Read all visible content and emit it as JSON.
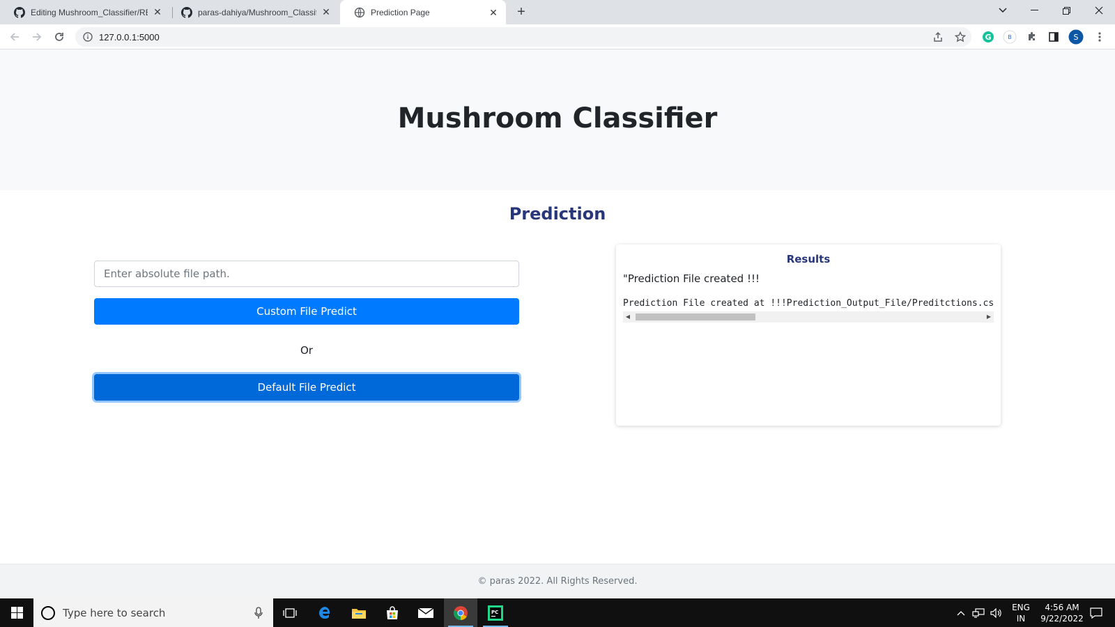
{
  "browser": {
    "tabs": [
      {
        "title": "Editing Mushroom_Classifier/REA",
        "icon": "github-icon"
      },
      {
        "title": "paras-dahiya/Mushroom_Classifi",
        "icon": "github-icon"
      },
      {
        "title": "Prediction Page",
        "icon": "globe-icon"
      }
    ],
    "url": "127.0.0.1:5000",
    "profile_initial": "S",
    "extension_initial": "B"
  },
  "page": {
    "heading": "Mushroom Classifier",
    "section_title": "Prediction",
    "file_path_placeholder": "Enter absolute file path.",
    "custom_button": "Custom File Predict",
    "or_text": "Or",
    "default_button": "Default File Predict",
    "results": {
      "title": "Results",
      "message": "\"Prediction File created !!!",
      "detail": "Prediction File created at !!!Prediction_Output_File/Preditctions.csv"
    },
    "footer": "© paras 2022. All Rights Reserved."
  },
  "taskbar": {
    "search_placeholder": "Type here to search",
    "language": "ENG",
    "region": "IN",
    "time": "4:56 AM",
    "date": "9/22/2022"
  },
  "colors": {
    "primary_button": "#007bff",
    "heading_blue": "#28367a",
    "hero_bg": "#f8f9fa"
  }
}
